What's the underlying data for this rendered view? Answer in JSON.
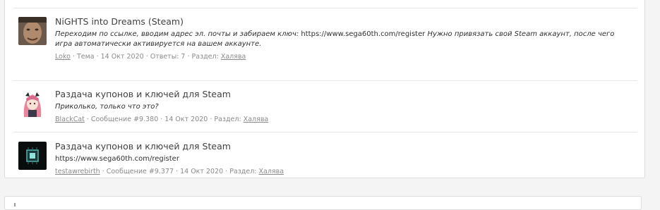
{
  "results": [
    {
      "title": "NiGHTS into Dreams (Steam)",
      "snippet_before": "Переходим по ссылке, вводим адрес эл. почты и забираем ключ: ",
      "snippet_link": "https://www.sega60th.com/register",
      "snippet_after": " Нужно привязать свой Steam аккаунт, после чего игра автоматически активируется на вашем аккаунте.",
      "author": "Loko",
      "type": "Тема",
      "date": "14 Окт 2020",
      "extra": "Ответы: 7",
      "section_label": "Раздел:",
      "section": "Халява"
    },
    {
      "title": "Раздача купонов и ключей для Steam",
      "snippet": "Приколько, только что это?",
      "author": "BlackCat",
      "type": "Сообщение #9.380",
      "date": "14 Окт 2020",
      "section_label": "Раздел:",
      "section": "Халява"
    },
    {
      "title": "Раздача купонов и ключей для Steam",
      "snippet": "https://www.sega60th.com/register",
      "author": "testawrebirth",
      "type": "Сообщение #9.377",
      "date": "14 Окт 2020",
      "section_label": "Раздел:",
      "section": "Халява"
    }
  ],
  "separator": "·"
}
